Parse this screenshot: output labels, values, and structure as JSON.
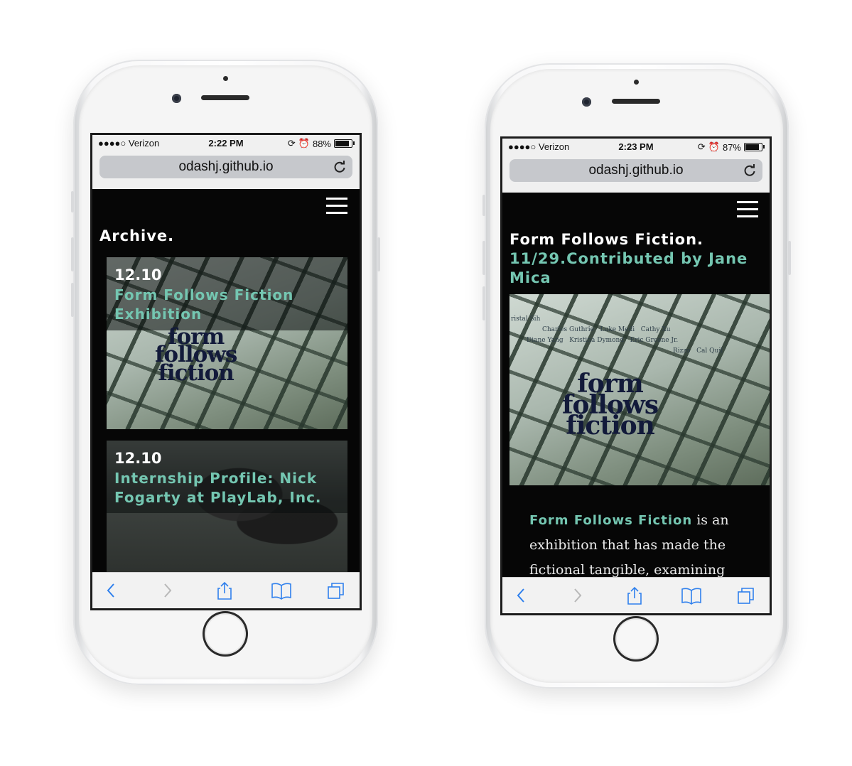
{
  "phones": [
    {
      "status": {
        "carrier": "●●●●○ Verizon",
        "time": "2:22 PM",
        "battery": "88%",
        "battery_level": 0.88
      },
      "url": "odashj.github.io",
      "page_title": "Archive.",
      "cards": [
        {
          "date": "12.10",
          "title_line1": "Form Follows Fiction",
          "title_line2": "Exhibition",
          "logo": [
            "form",
            "follows",
            "fiction"
          ]
        },
        {
          "date": "12.10",
          "title_line1": "Internship Profile: Nick",
          "title_line2": "Fogarty at PlayLab, Inc."
        }
      ]
    },
    {
      "status": {
        "carrier": "●●●●○ Verizon",
        "time": "2:23 PM",
        "battery": "87%",
        "battery_level": 0.87
      },
      "url": "odashj.github.io",
      "title": "Form Follows Fiction.",
      "subtitle_line1": "11/29.Contributed by Jane",
      "subtitle_line2": "Mica",
      "logo": [
        "form",
        "follows",
        "fiction"
      ],
      "names": [
        "ristal Sih",
        "Charles Guthrie",
        "Luke Medi",
        "Cathy Xu",
        "Diane Yang",
        "Kristina Dymond",
        "Eric Greene Jr.",
        "Rizzo",
        "Cal Quil"
      ],
      "body_link": "Form Follows Fiction",
      "body_rest_line1": " is an",
      "body_line2": "exhibition that has made the",
      "body_line3": "fictional tangible, examining"
    }
  ],
  "toolbar": {
    "back": "back-chevron",
    "forward": "forward-chevron",
    "share": "share",
    "bookmarks": "bookmarks",
    "tabs": "tabs"
  },
  "colors": {
    "accent": "#74c6b1",
    "page_bg": "#060606"
  }
}
